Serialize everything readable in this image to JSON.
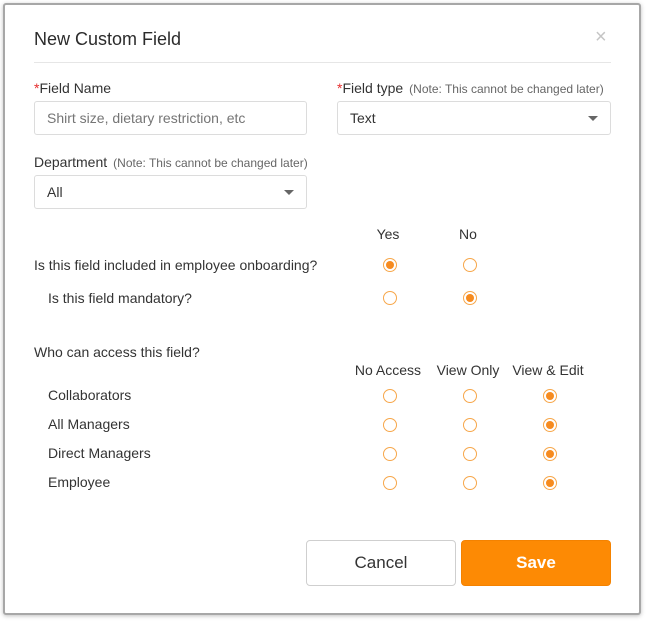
{
  "dialog": {
    "title": "New Custom Field",
    "close_glyph": "×"
  },
  "field_name": {
    "required_mark": "*",
    "label": "Field Name",
    "placeholder": "Shirt size, dietary restriction, etc",
    "value": ""
  },
  "field_type": {
    "required_mark": "*",
    "label": "Field type",
    "note": "(Note: This cannot be changed later)",
    "value": "Text"
  },
  "department": {
    "label": "Department",
    "note": "(Note: This cannot be changed later)",
    "value": "All"
  },
  "onboarding": {
    "yes_header": "Yes",
    "no_header": "No",
    "questions": [
      {
        "label": "Is this field included in employee onboarding?",
        "selected": "Yes"
      },
      {
        "label": "Is this field mandatory?",
        "selected": "No"
      }
    ]
  },
  "access": {
    "label": "Who can access this field?",
    "columns": [
      "No Access",
      "View Only",
      "View & Edit"
    ],
    "rows": [
      {
        "label": "Collaborators",
        "selected": "View & Edit"
      },
      {
        "label": "All Managers",
        "selected": "View & Edit"
      },
      {
        "label": "Direct Managers",
        "selected": "View & Edit"
      },
      {
        "label": "Employee",
        "selected": "View & Edit"
      }
    ]
  },
  "footer": {
    "cancel_label": "Cancel",
    "save_label": "Save"
  },
  "colors": {
    "accent": "#fd8a04",
    "radio_border": "#f7a74a",
    "required": "#e52d2d"
  }
}
